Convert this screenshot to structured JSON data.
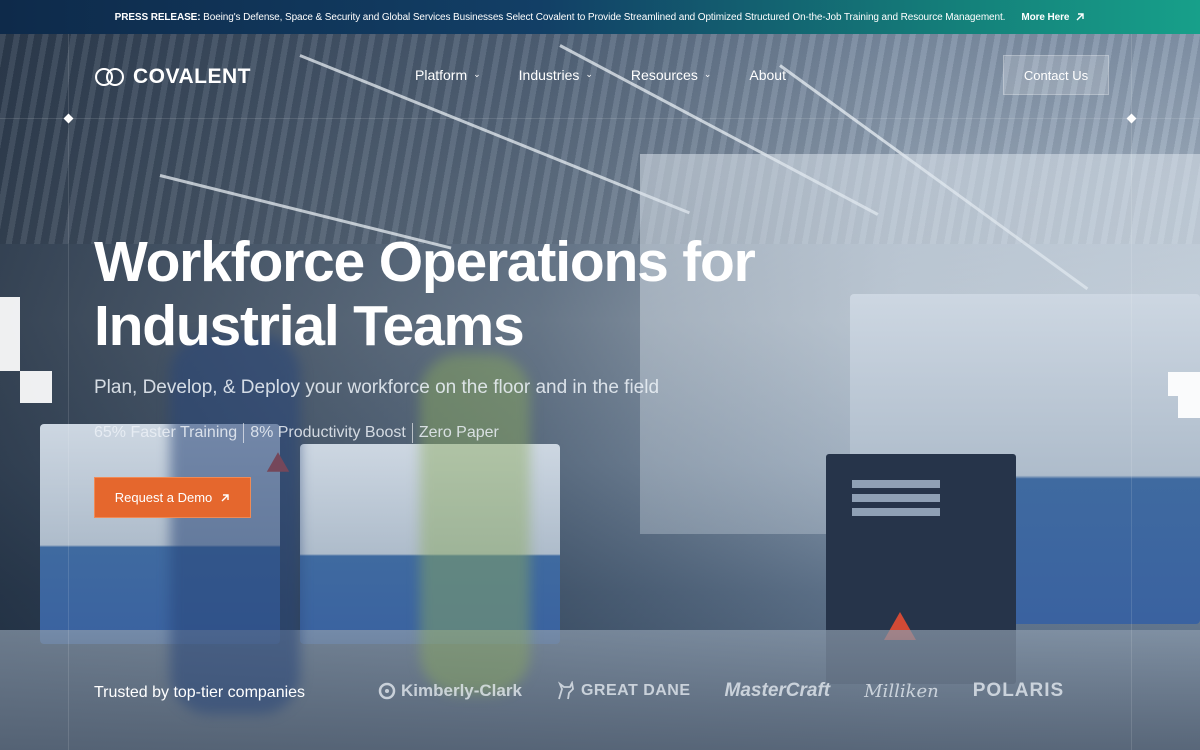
{
  "announcement": {
    "label": "PRESS RELEASE:",
    "text": "Boeing's Defense, Space & Security and Global Services Businesses Select Covalent to Provide Streamlined and Optimized Structured On-the-Job Training and Resource Management.",
    "link": "More Here",
    "link_icon": "arrow-up-right-icon"
  },
  "nav": {
    "logo_text": "COVALENT",
    "items": [
      {
        "label": "Platform",
        "has_dropdown": true
      },
      {
        "label": "Industries",
        "has_dropdown": true
      },
      {
        "label": "Resources",
        "has_dropdown": true
      },
      {
        "label": "About",
        "has_dropdown": false
      }
    ],
    "contact": "Contact Us"
  },
  "hero": {
    "headline_line1": "Workforce Operations for",
    "headline_line2": "Industrial Teams",
    "subhead": "Plan, Develop, & Deploy your workforce on the floor and in the field",
    "stats": [
      "65% Faster Training",
      "8% Productivity Boost",
      "Zero Paper"
    ],
    "cta": "Request a Demo"
  },
  "trusted": {
    "label": "Trusted by top-tier companies",
    "logos": [
      "Kimberly-Clark",
      "GREAT DANE",
      "MasterCraft",
      "Milliken",
      "POLARIS"
    ]
  },
  "colors": {
    "accent": "#e5672d",
    "banner_start": "#0e2a4a",
    "banner_end": "#17a08a"
  }
}
